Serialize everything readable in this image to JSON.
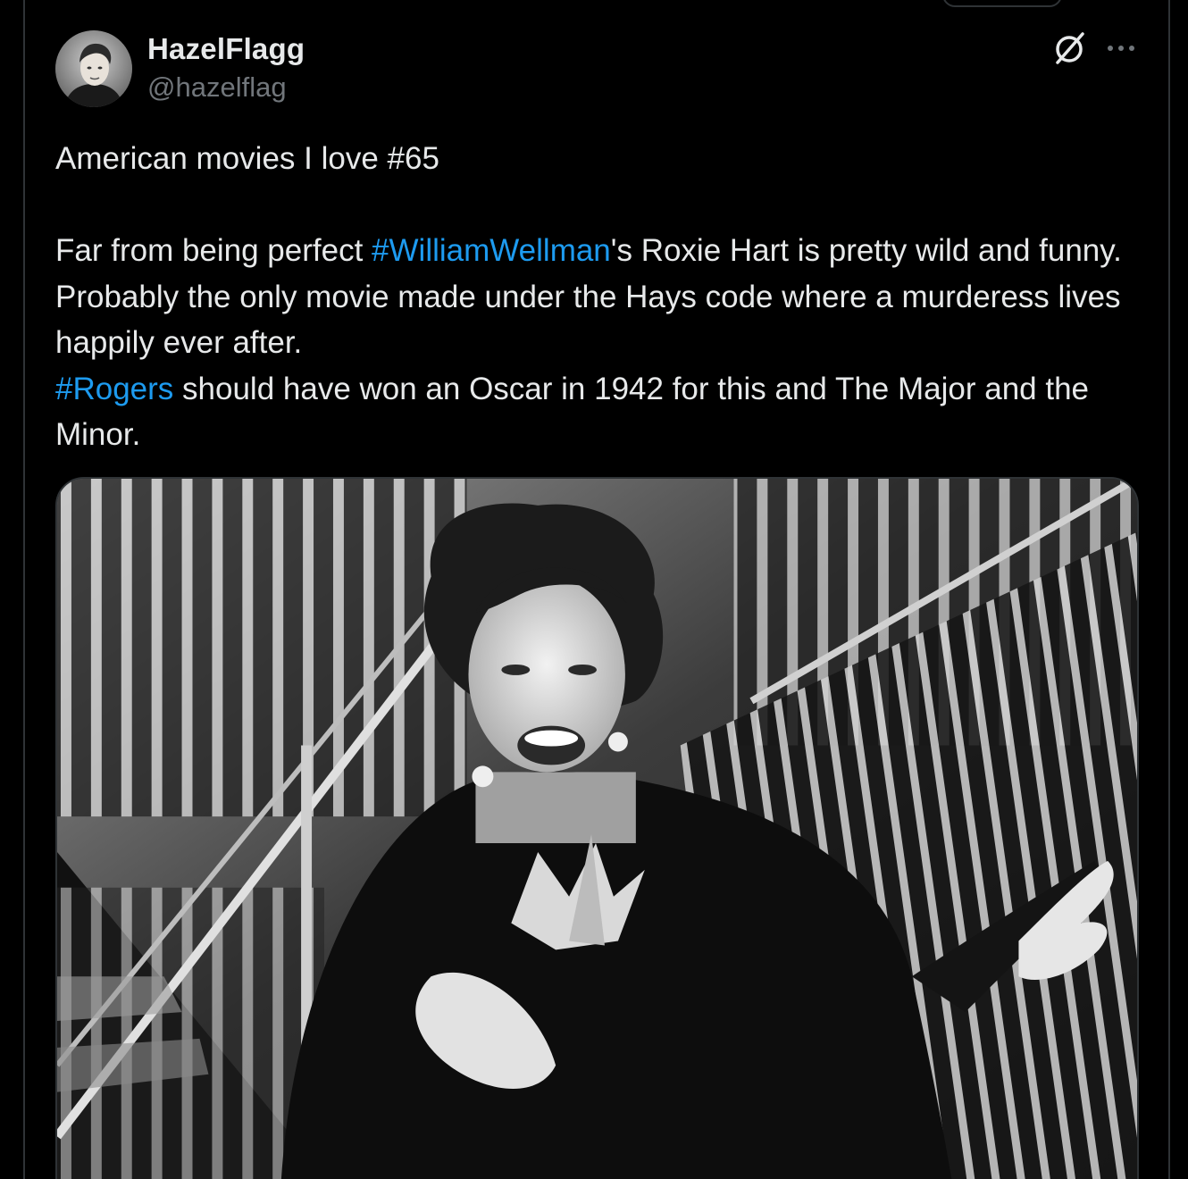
{
  "post": {
    "author": {
      "display_name": "HazelFlagg",
      "handle": "@hazelflag",
      "avatar_icon": "avatar-photo"
    },
    "actions": {
      "grok_icon": "grok-icon",
      "more_icon": "more-icon"
    },
    "text": {
      "line1": "American movies I love #65",
      "p2_part1": "Far from being perfect ",
      "p2_hashtag": "#WilliamWellman",
      "p2_part2": "'s Roxie Hart is  pretty wild and funny. Probably the only movie made under the Hays code where a murderess lives happily ever after.",
      "p3_hashtag": "#Rogers",
      "p3_part2": " should have won an Oscar in 1942 for this and The Major and the Minor."
    },
    "media": {
      "type": "image",
      "tone": "black-and-white photo"
    }
  },
  "colors": {
    "background": "#000000",
    "text": "#e7e9ea",
    "secondary_text": "#71767b",
    "link": "#1d9bf0",
    "border": "#2f3336"
  }
}
